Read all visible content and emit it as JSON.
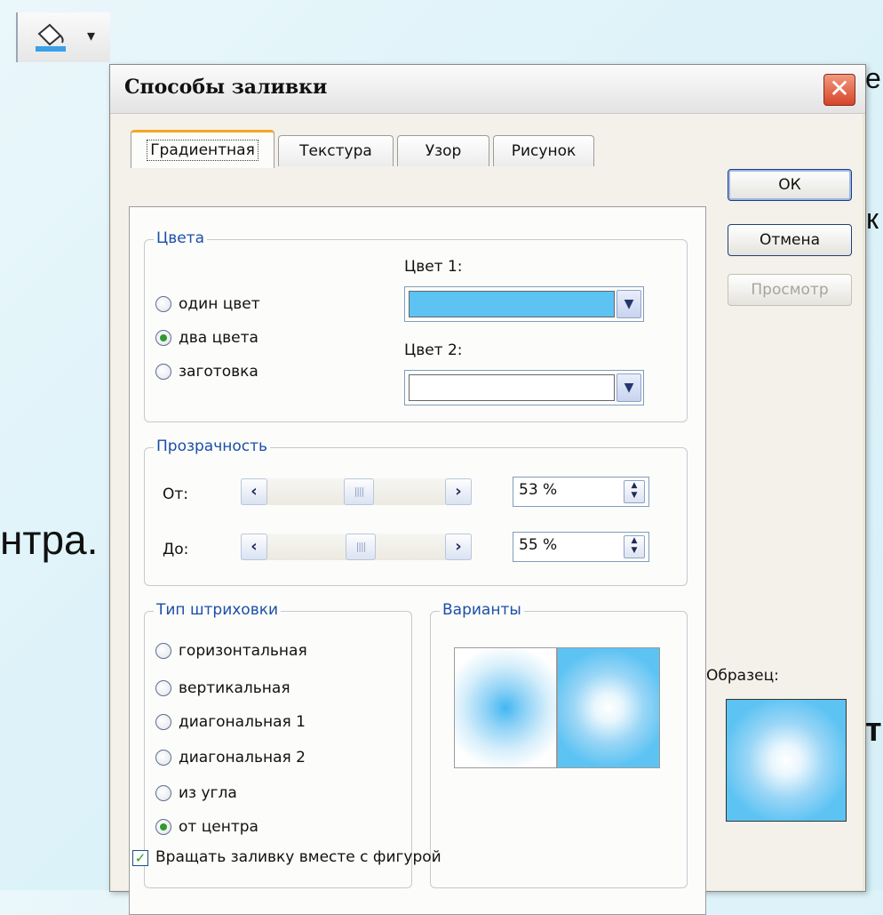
{
  "background": {
    "fragment_top_right": "е",
    "fragment_right_1": "к",
    "fragment_left": "нтра.",
    "fragment_right_2": "т"
  },
  "toolbar": {
    "fill_icon": "paint-bucket-icon",
    "arrow": "▾"
  },
  "dialog": {
    "title": "Способы заливки",
    "close_glyph": "✕",
    "tabs": [
      "Градиентная",
      "Текстура",
      "Узор",
      "Рисунок"
    ],
    "colors_group": {
      "label": "Цвета",
      "radios": [
        "один цвет",
        "два цвета",
        "заготовка"
      ],
      "selected": "два цвета",
      "color1_label": "Цвет 1:",
      "color2_label": "Цвет 2:",
      "color1_value": "#5dc3f3",
      "color2_value": "#ffffff"
    },
    "transparency_group": {
      "label": "Прозрачность",
      "from_label": "От:",
      "to_label": "До:",
      "from_value": "53 %",
      "to_value": "55 %"
    },
    "shading_group": {
      "label": "Тип штриховки",
      "radios": [
        "горизонтальная",
        "вертикальная",
        "диагональная 1",
        "диагональная 2",
        "из угла",
        "от центра"
      ],
      "selected": "от центра"
    },
    "variants_group": {
      "label": "Варианты"
    },
    "buttons": {
      "ok": "ОК",
      "cancel": "Отмена",
      "preview": "Просмотр"
    },
    "sample_label": "Образец:",
    "rotate_checkbox": {
      "label": "Вращать заливку вместе с фигурой",
      "checked": true
    }
  }
}
